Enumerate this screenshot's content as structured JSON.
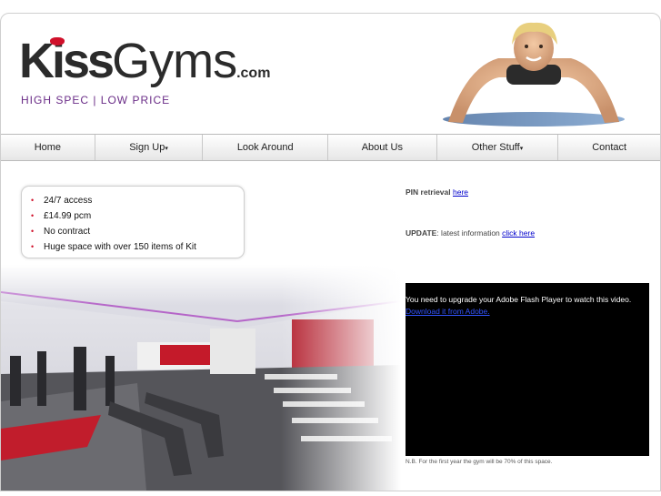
{
  "brand": {
    "kiss": "Kiss",
    "gyms": "Gyms",
    "com": ".com",
    "tagline": "HIGH SPEC | LOW PRICE"
  },
  "nav": {
    "items": [
      {
        "label": "Home",
        "dropdown": false
      },
      {
        "label": "Sign Up",
        "dropdown": true
      },
      {
        "label": "Look Around",
        "dropdown": false
      },
      {
        "label": "About Us",
        "dropdown": false
      },
      {
        "label": "Other Stuff",
        "dropdown": true
      },
      {
        "label": "Contact",
        "dropdown": false
      }
    ],
    "caret": "▾"
  },
  "features": [
    "24/7 access",
    "£14.99 pcm",
    "No contract",
    "Huge space with over 150 items of Kit"
  ],
  "bullet": "•",
  "pin": {
    "label": "PIN retrieval",
    "link": "here"
  },
  "update": {
    "label": "UPDATE",
    "text": ": latest information ",
    "link": "click here"
  },
  "flash": {
    "message": "You need to upgrade your Adobe Flash Player to watch this video.",
    "link": "Download it from Adobe."
  },
  "note": "N.B. For the first year the gym will be 70% of this space.",
  "colors": {
    "accent": "#d0102a",
    "tagline": "#6a2c87",
    "link": "#0000cc"
  }
}
